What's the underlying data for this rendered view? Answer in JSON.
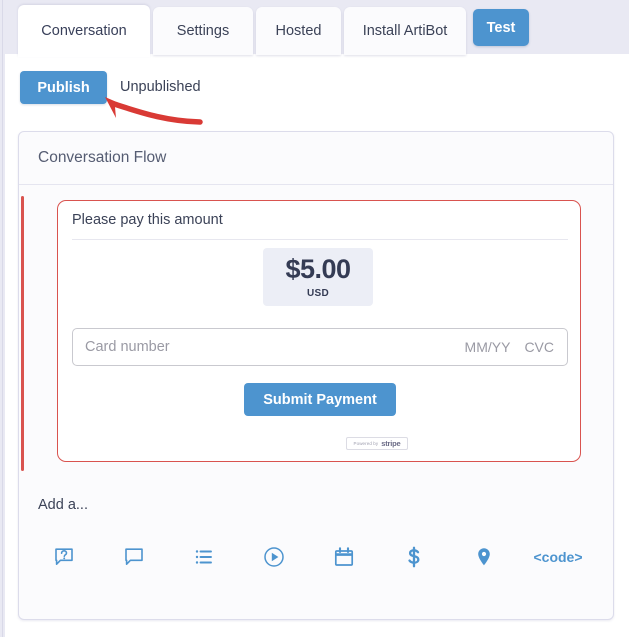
{
  "tabs": [
    {
      "id": "conversation",
      "label": "Conversation",
      "active": true
    },
    {
      "id": "settings",
      "label": "Settings",
      "active": false
    },
    {
      "id": "hosted",
      "label": "Hosted",
      "active": false
    },
    {
      "id": "install",
      "label": "Install ArtiBot",
      "active": false
    }
  ],
  "test_button": {
    "label": "Test"
  },
  "publish_bar": {
    "publish_label": "Publish",
    "status_label": "Unpublished"
  },
  "flow_card": {
    "title": "Conversation Flow"
  },
  "payment_card": {
    "title": "Please pay this amount",
    "amount": "$5.00",
    "currency": "USD",
    "card_number_placeholder": "Card number",
    "expiry_placeholder": "MM/YY",
    "cvc_placeholder": "CVC",
    "submit_label": "Submit Payment",
    "stripe_powered_by": "Powered by",
    "stripe_wordmark": "stripe"
  },
  "add_section": {
    "label": "Add a...",
    "icons": [
      {
        "name": "question-bubble-icon",
        "title": "Question"
      },
      {
        "name": "chat-bubble-icon",
        "title": "Message"
      },
      {
        "name": "list-icon",
        "title": "List"
      },
      {
        "name": "play-circle-icon",
        "title": "Video"
      },
      {
        "name": "calendar-icon",
        "title": "Calendar"
      },
      {
        "name": "dollar-icon",
        "title": "Payment"
      },
      {
        "name": "map-pin-icon",
        "title": "Location"
      },
      {
        "name": "code-icon",
        "title": "<code>"
      }
    ],
    "code_label": "<code>"
  },
  "colors": {
    "accent_blue": "#4d94cf",
    "annotation_red": "#d9534f",
    "page_background": "#e9e9f3",
    "amount_background": "#eceef6",
    "text_dark": "#3b4257"
  }
}
